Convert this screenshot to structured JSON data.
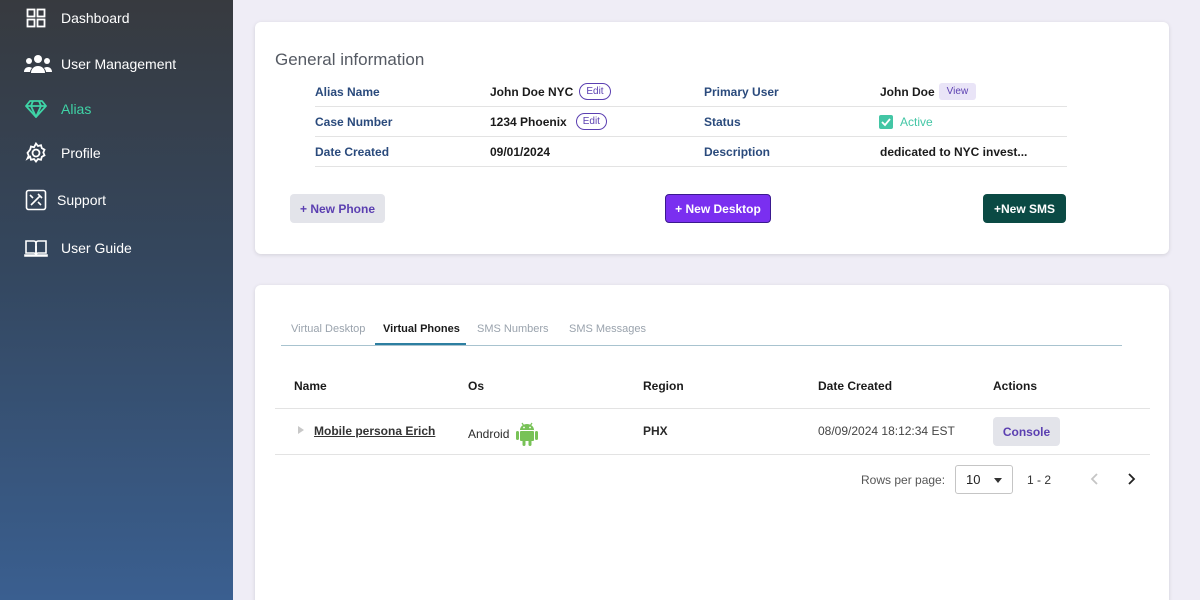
{
  "sidebar": {
    "items": [
      {
        "label": "Dashboard",
        "icon": "dashboard-icon"
      },
      {
        "label": "User Management",
        "icon": "users-icon"
      },
      {
        "label": "Alias",
        "icon": "diamond-icon",
        "active": true
      },
      {
        "label": "Profile",
        "icon": "gear-icon"
      },
      {
        "label": "Support",
        "icon": "tools-icon"
      },
      {
        "label": "User Guide",
        "icon": "book-icon"
      }
    ],
    "active_color": "#3fd4a6"
  },
  "general": {
    "title": "General information",
    "alias_label": "Alias Name",
    "alias_value": "John Doe NYC",
    "alias_edit": "Edit",
    "case_label": "Case Number",
    "case_value": "1234 Phoenix",
    "case_edit": "Edit",
    "date_label": "Date Created",
    "date_value": "09/01/2024",
    "primary_label": "Primary User",
    "primary_value": "John Doe",
    "primary_view": "View",
    "status_label": "Status",
    "status_value": "Active",
    "desc_label": "Description",
    "desc_value": "dedicated to NYC invest...",
    "buttons": {
      "new_phone": "+ New Phone",
      "new_desktop": "+ New Desktop",
      "new_sms": "+New SMS"
    }
  },
  "tabs": [
    {
      "label": "Virtual Desktop"
    },
    {
      "label": "Virtual Phones",
      "active": true
    },
    {
      "label": "SMS Numbers"
    },
    {
      "label": "SMS Messages"
    }
  ],
  "table": {
    "headers": [
      "Name",
      "Os",
      "Region",
      "Date Created",
      "Actions"
    ],
    "rows": [
      {
        "name": "Mobile persona Erich",
        "os": "Android",
        "os_icon": "android-icon",
        "region": "PHX",
        "date_created": "08/09/2024 18:12:34 EST",
        "action": "Console"
      }
    ]
  },
  "pagination": {
    "rows_per_page_label": "Rows per page:",
    "rows_per_page": "10",
    "range": "1 - 2"
  },
  "colors": {
    "primary_purple": "#7a2ff0",
    "teal_dark": "#0b4a44",
    "active_green": "#43c6a5"
  }
}
